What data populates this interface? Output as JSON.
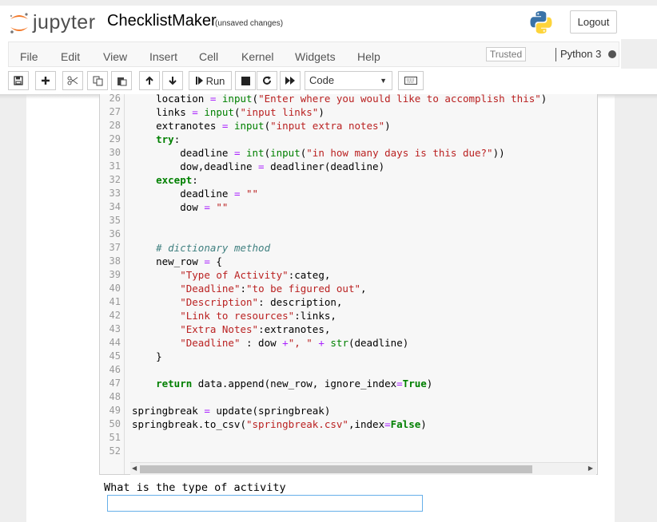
{
  "header": {
    "logo_text": "jupyter",
    "notebook_title": "ChecklistMaker",
    "save_status": "(unsaved changes)",
    "logout_label": "Logout"
  },
  "menubar": {
    "items": [
      "File",
      "Edit",
      "View",
      "Insert",
      "Cell",
      "Kernel",
      "Widgets",
      "Help"
    ],
    "trusted_label": "Trusted",
    "kernel_name": "Python 3"
  },
  "toolbar": {
    "buttons": [
      "save-icon",
      "plus-icon",
      "scissors-icon",
      "copy-icon",
      "paste-icon",
      "arrow-up-icon",
      "arrow-down-icon",
      "run",
      "stop-icon",
      "restart-icon",
      "fast-forward-icon",
      "keyboard-icon"
    ],
    "run_label": "Run",
    "cell_type": "Code"
  },
  "code": {
    "lines": [
      {
        "n": "26",
        "html": "    location <span class=\"o\">=</span> <span class=\"b\">input</span>(<span class=\"s\">\"Enter where you would like to accomplish this\"</span>)"
      },
      {
        "n": "27",
        "html": "    links <span class=\"o\">=</span> <span class=\"b\">input</span>(<span class=\"s\">\"input links\"</span>)"
      },
      {
        "n": "28",
        "html": "    extranotes <span class=\"o\">=</span> <span class=\"b\">input</span>(<span class=\"s\">\"input extra notes\"</span>)"
      },
      {
        "n": "29",
        "html": "    <span class=\"k\">try</span>:"
      },
      {
        "n": "30",
        "html": "        deadline <span class=\"o\">=</span> <span class=\"b\">int</span>(<span class=\"b\">input</span>(<span class=\"s\">\"in how many days is this due?\"</span>))"
      },
      {
        "n": "31",
        "html": "        dow,deadline <span class=\"o\">=</span> deadliner(deadline)"
      },
      {
        "n": "32",
        "html": "    <span class=\"k\">except</span>:"
      },
      {
        "n": "33",
        "html": "        deadline <span class=\"o\">=</span> <span class=\"s\">\"\"</span>"
      },
      {
        "n": "34",
        "html": "        dow <span class=\"o\">=</span> <span class=\"s\">\"\"</span>"
      },
      {
        "n": "35",
        "html": ""
      },
      {
        "n": "36",
        "html": ""
      },
      {
        "n": "37",
        "html": "    <span class=\"c\"># dictionary method</span>"
      },
      {
        "n": "38",
        "html": "    new_row <span class=\"o\">=</span> {"
      },
      {
        "n": "39",
        "html": "        <span class=\"s\">\"Type of Activity\"</span>:categ,"
      },
      {
        "n": "40",
        "html": "        <span class=\"s\">\"Deadline\"</span>:<span class=\"s\">\"to be figured out\"</span>,"
      },
      {
        "n": "41",
        "html": "        <span class=\"s\">\"Description\"</span>: description,"
      },
      {
        "n": "42",
        "html": "        <span class=\"s\">\"Link to resources\"</span>:links,"
      },
      {
        "n": "43",
        "html": "        <span class=\"s\">\"Extra Notes\"</span>:extranotes,"
      },
      {
        "n": "44",
        "html": "        <span class=\"s\">\"Deadline\"</span> : dow <span class=\"o\">+</span><span class=\"s\">\", \"</span> <span class=\"o\">+</span> <span class=\"b\">str</span>(deadline)"
      },
      {
        "n": "45",
        "html": "    }"
      },
      {
        "n": "46",
        "html": ""
      },
      {
        "n": "47",
        "html": "    <span class=\"k\">return</span> data.append(new_row, ignore_index<span class=\"o\">=</span><span class=\"k\">True</span>)"
      },
      {
        "n": "48",
        "html": ""
      },
      {
        "n": "49",
        "html": "springbreak <span class=\"o\">=</span> update(springbreak)"
      },
      {
        "n": "50",
        "html": "springbreak.to_csv(<span class=\"s\">\"springbreak.csv\"</span>,index<span class=\"o\">=</span><span class=\"k\">False</span>)"
      },
      {
        "n": "51",
        "html": ""
      },
      {
        "n": "52",
        "html": ""
      }
    ]
  },
  "output": {
    "prompt": "What is the type of activity",
    "input_value": ""
  },
  "colors": {
    "keyword": "#008000",
    "string": "#ba2121",
    "operator": "#aa22ff",
    "comment": "#408080",
    "logo_orange": "#f37726"
  }
}
